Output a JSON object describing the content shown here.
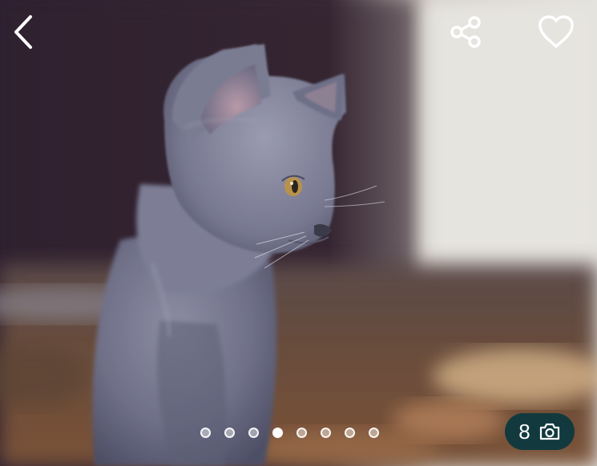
{
  "icons": {
    "back": "chevron-left-icon",
    "share": "share-icon",
    "favorite": "heart-outline-icon",
    "camera": "camera-icon"
  },
  "gallery": {
    "photo_subject": "grey kitten",
    "photo_count": "8",
    "dot_count": 8,
    "active_index": 4
  },
  "colors": {
    "counter_bg": "#123a3e",
    "icon": "#ffffff"
  }
}
